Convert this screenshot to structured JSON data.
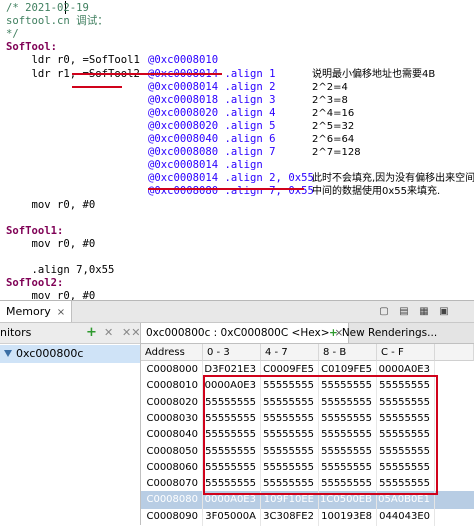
{
  "editor": {
    "lines": [
      {
        "text": "/* 2021-02-19",
        "style": "c"
      },
      {
        "text": "softool.cn 调试：",
        "style": "c"
      },
      {
        "text": "*/",
        "style": "c"
      },
      {
        "text": "SofTool:",
        "style": "lbl"
      },
      {
        "text": "    ldr r0, =SofTool1",
        "extra": "@0xc0008010",
        "style": "code"
      },
      {
        "text": "    ldr r1, =SofTool2",
        "extra": "@0xc0008014 .align 1",
        "note": "说明最小偏移地址也需要4B",
        "style": "code"
      },
      {
        "text": "",
        "extra": "@0xc0008014 .align 2",
        "note": "2^2=4",
        "style": "code"
      },
      {
        "text": "",
        "extra": "@0xc0008018 .align 3",
        "note": "2^3=8",
        "style": "code"
      },
      {
        "text": "",
        "extra": "@0xc0008020 .align 4",
        "note": "2^4=16",
        "style": "code"
      },
      {
        "text": "",
        "extra": "@0xc0008020 .align 5",
        "note": "2^5=32",
        "style": "code"
      },
      {
        "text": "",
        "extra": "@0xc0008040 .align 6",
        "note": "2^6=64",
        "style": "code"
      },
      {
        "text": "",
        "extra": "@0xc0008080 .align 7",
        "note": "2^7=128",
        "style": "code"
      },
      {
        "text": "",
        "extra": "@0xc0008014 .align",
        "style": "code"
      },
      {
        "text": "",
        "extra": "@0xc0008014 .align 2, 0x55",
        "note": "此时不会填充,因为没有偏移出来空间.",
        "style": "code"
      },
      {
        "text": "",
        "extra": "@0xc0008080 .align 7, 0x55",
        "note": "中间的数据使用0x55来填充.",
        "style": "code"
      },
      {
        "text": "    mov r0, #0",
        "style": "code"
      },
      {
        "text": "",
        "style": "code"
      },
      {
        "text": "SofTool1:",
        "style": "lbl"
      },
      {
        "text": "    mov r0, #0",
        "style": "code"
      },
      {
        "text": "",
        "style": "code"
      },
      {
        "text": "    .align 7,0x55",
        "style": "code"
      },
      {
        "text": "SofTool2:",
        "style": "lbl"
      },
      {
        "text": "    mov r0, #0",
        "style": "code"
      }
    ]
  },
  "memory_view": {
    "tab_label": "Memory",
    "monitors_label": "nitors",
    "monitor_item": "0xc000800c",
    "rendering_tab": "0xc000800c : 0xC000800C <Hex>",
    "new_renderings_label": "New Renderings...",
    "columns": [
      "Address",
      "0 - 3",
      "4 - 7",
      "8 - B",
      "C - F"
    ],
    "rows": [
      {
        "addr": "C0008000",
        "v": [
          "D3F021E3",
          "C0009FE5",
          "C0109FE5",
          "0000A0E3"
        ]
      },
      {
        "addr": "C0008010",
        "v": [
          "0000A0E3",
          "55555555",
          "55555555",
          "55555555"
        ]
      },
      {
        "addr": "C0008020",
        "v": [
          "55555555",
          "55555555",
          "55555555",
          "55555555"
        ]
      },
      {
        "addr": "C0008030",
        "v": [
          "55555555",
          "55555555",
          "55555555",
          "55555555"
        ]
      },
      {
        "addr": "C0008040",
        "v": [
          "55555555",
          "55555555",
          "55555555",
          "55555555"
        ]
      },
      {
        "addr": "C0008050",
        "v": [
          "55555555",
          "55555555",
          "55555555",
          "55555555"
        ]
      },
      {
        "addr": "C0008060",
        "v": [
          "55555555",
          "55555555",
          "55555555",
          "55555555"
        ]
      },
      {
        "addr": "C0008070",
        "v": [
          "55555555",
          "55555555",
          "55555555",
          "55555555"
        ]
      },
      {
        "addr": "C0008080",
        "v": [
          "0000A0E3",
          "109F10EE",
          "1C0500EB",
          "05A0B0E1"
        ],
        "selected": true
      },
      {
        "addr": "C0008090",
        "v": [
          "3F05000A",
          "3C308FE2",
          "100193E8",
          "044043E0"
        ]
      }
    ]
  },
  "icons": {
    "close": "×",
    "add_monitor": "+",
    "remove_monitor": "✕",
    "remove_all": "✕✕",
    "toolbar": [
      "▢",
      "▤",
      "▦",
      "▣"
    ]
  },
  "colors": {
    "highlight": "#d0021b",
    "selection": "#b8cde4",
    "comment": "#3f7f5f",
    "keyword": "#7f0055",
    "address": "#2a00ff"
  }
}
